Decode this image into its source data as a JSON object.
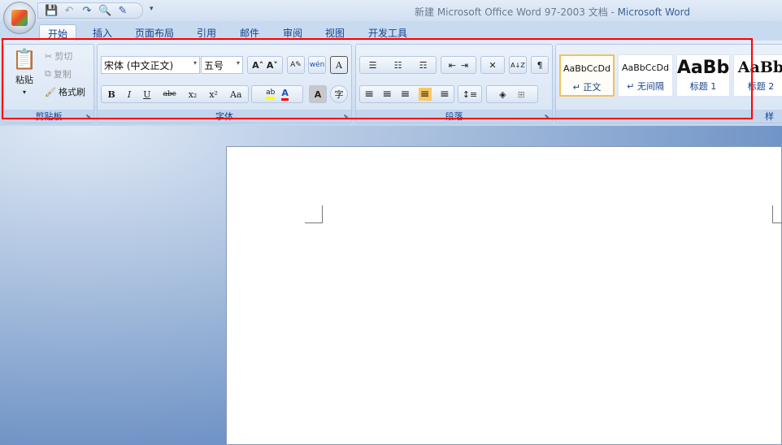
{
  "window": {
    "title_doc": "新建 Microsoft Office Word 97-2003 文档",
    "title_sep": " - ",
    "title_app": "Microsoft Word"
  },
  "qat": {
    "save": "💾",
    "undo": "↶",
    "redo": "↷",
    "preview": "🔍",
    "edit": "✎",
    "more": "▾"
  },
  "tabs": [
    "开始",
    "插入",
    "页面布局",
    "引用",
    "邮件",
    "审阅",
    "视图",
    "开发工具"
  ],
  "clipboard": {
    "paste": "粘贴",
    "cut": "剪切",
    "copy": "复制",
    "format_painter": "格式刷",
    "label": "剪贴板"
  },
  "font": {
    "name": "宋体 (中文正文)",
    "size": "五号",
    "label": "字体",
    "grow": "A˄",
    "shrink": "A˅",
    "clear": "A✎",
    "phonetic": "wén",
    "border": "A",
    "bold": "B",
    "italic": "I",
    "underline": "U",
    "strike": "abc",
    "sub": "x₂",
    "sup": "x²",
    "case": "Aa",
    "highlight": "ab",
    "color": "A",
    "shade": "A",
    "enclose": "字"
  },
  "paragraph": {
    "label": "段落",
    "bullets": "☰",
    "numbering": "☷",
    "multilevel": "☶",
    "dec_indent": "⇤",
    "inc_indent": "⇥",
    "chinese_layout": "✕",
    "sort": "A↓Z",
    "marks": "¶",
    "left": "≡",
    "center": "≡",
    "right": "≡",
    "justify": "≡",
    "distributed": "≡",
    "line_spacing": "↕≡",
    "shading": "◈",
    "borders": "⊞"
  },
  "styles": {
    "label": "样",
    "items": [
      {
        "preview": "AaBbCcDd",
        "name": "↵ 正文"
      },
      {
        "preview": "AaBbCcDd",
        "name": "↵ 无间隔"
      },
      {
        "preview": "AaBb",
        "name": "标题 1"
      },
      {
        "preview": "AaBb",
        "name": "标题 2"
      }
    ]
  },
  "colors": {
    "highlight": "#ffff00",
    "font_color": "#ff0000",
    "red_box": "#ff0000"
  }
}
